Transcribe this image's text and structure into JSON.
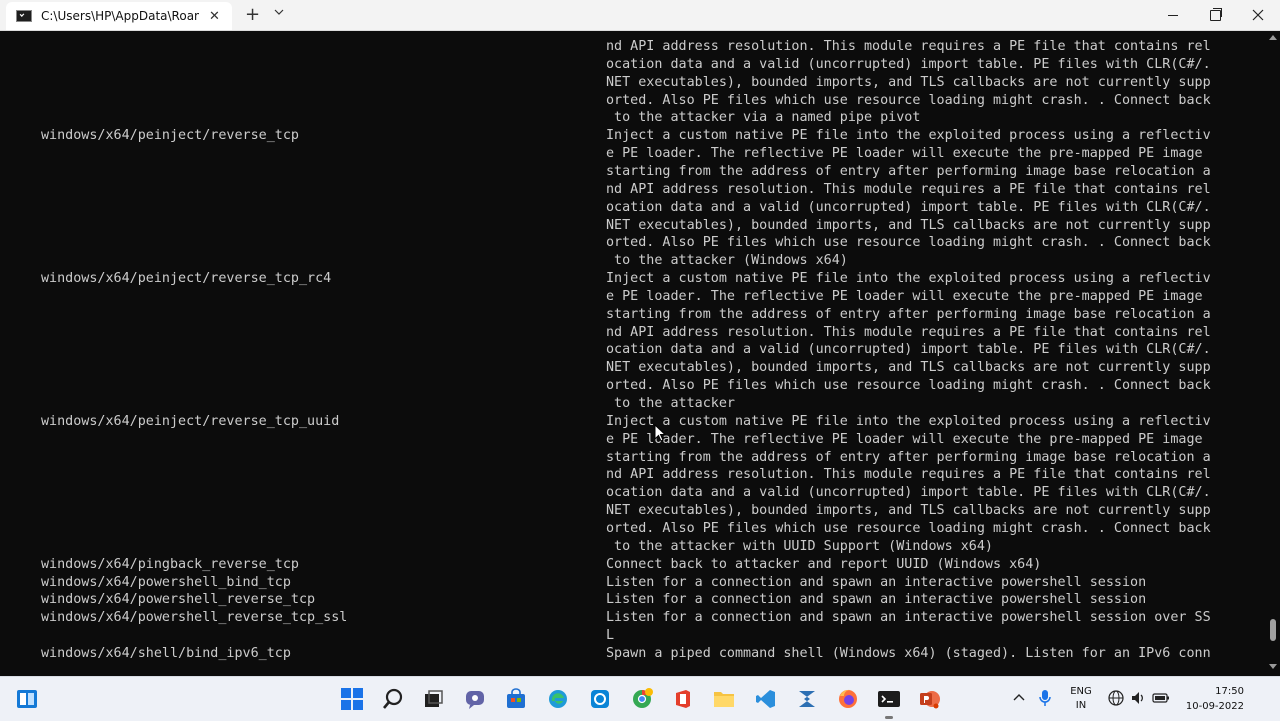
{
  "window": {
    "tab_title": "C:\\Users\\HP\\AppData\\Roaming",
    "tab_close": "✕",
    "new_tab": "+",
    "dropdown": "⌄"
  },
  "terminal": {
    "lines": [
      {
        "name": "",
        "desc": "nd API address resolution. This module requires a PE file that contains rel"
      },
      {
        "name": "",
        "desc": "ocation data and a valid (uncorrupted) import table. PE files with CLR(C#/."
      },
      {
        "name": "",
        "desc": "NET executables), bounded imports, and TLS callbacks are not currently supp"
      },
      {
        "name": "",
        "desc": "orted. Also PE files which use resource loading might crash. . Connect back"
      },
      {
        "name": "",
        "desc": " to the attacker via a named pipe pivot"
      },
      {
        "name": "windows/x64/peinject/reverse_tcp",
        "desc": "Inject a custom native PE file into the exploited process using a reflectiv"
      },
      {
        "name": "",
        "desc": "e PE loader. The reflective PE loader will execute the pre-mapped PE image"
      },
      {
        "name": "",
        "desc": "starting from the address of entry after performing image base relocation a"
      },
      {
        "name": "",
        "desc": "nd API address resolution. This module requires a PE file that contains rel"
      },
      {
        "name": "",
        "desc": "ocation data and a valid (uncorrupted) import table. PE files with CLR(C#/."
      },
      {
        "name": "",
        "desc": "NET executables), bounded imports, and TLS callbacks are not currently supp"
      },
      {
        "name": "",
        "desc": "orted. Also PE files which use resource loading might crash. . Connect back"
      },
      {
        "name": "",
        "desc": " to the attacker (Windows x64)"
      },
      {
        "name": "windows/x64/peinject/reverse_tcp_rc4",
        "desc": "Inject a custom native PE file into the exploited process using a reflectiv"
      },
      {
        "name": "",
        "desc": "e PE loader. The reflective PE loader will execute the pre-mapped PE image"
      },
      {
        "name": "",
        "desc": "starting from the address of entry after performing image base relocation a"
      },
      {
        "name": "",
        "desc": "nd API address resolution. This module requires a PE file that contains rel"
      },
      {
        "name": "",
        "desc": "ocation data and a valid (uncorrupted) import table. PE files with CLR(C#/."
      },
      {
        "name": "",
        "desc": "NET executables), bounded imports, and TLS callbacks are not currently supp"
      },
      {
        "name": "",
        "desc": "orted. Also PE files which use resource loading might crash. . Connect back"
      },
      {
        "name": "",
        "desc": " to the attacker"
      },
      {
        "name": "windows/x64/peinject/reverse_tcp_uuid",
        "desc": "Inject a custom native PE file into the exploited process using a reflectiv"
      },
      {
        "name": "",
        "desc": "e PE loader. The reflective PE loader will execute the pre-mapped PE image"
      },
      {
        "name": "",
        "desc": "starting from the address of entry after performing image base relocation a"
      },
      {
        "name": "",
        "desc": "nd API address resolution. This module requires a PE file that contains rel"
      },
      {
        "name": "",
        "desc": "ocation data and a valid (uncorrupted) import table. PE files with CLR(C#/."
      },
      {
        "name": "",
        "desc": "NET executables), bounded imports, and TLS callbacks are not currently supp"
      },
      {
        "name": "",
        "desc": "orted. Also PE files which use resource loading might crash. . Connect back"
      },
      {
        "name": "",
        "desc": " to the attacker with UUID Support (Windows x64)"
      },
      {
        "name": "windows/x64/pingback_reverse_tcp",
        "desc": "Connect back to attacker and report UUID (Windows x64)"
      },
      {
        "name": "windows/x64/powershell_bind_tcp",
        "desc": "Listen for a connection and spawn an interactive powershell session"
      },
      {
        "name": "windows/x64/powershell_reverse_tcp",
        "desc": "Listen for a connection and spawn an interactive powershell session"
      },
      {
        "name": "windows/x64/powershell_reverse_tcp_ssl",
        "desc": "Listen for a connection and spawn an interactive powershell session over SS"
      },
      {
        "name": "",
        "desc": "L"
      },
      {
        "name": "windows/x64/shell/bind_ipv6_tcp",
        "desc": "Spawn a piped command shell (Windows x64) (staged). Listen for an IPv6 conn"
      }
    ]
  },
  "taskbar": {
    "language": {
      "line1": "ENG",
      "line2": "IN"
    },
    "time": "17:50",
    "date": "10-09-2022"
  },
  "colors": {
    "terminal_bg": "#0c0c0c",
    "terminal_fg": "#cccccc",
    "titlebar_bg": "#f3f3f3",
    "taskbar_bg": "#eef1f7",
    "windows_blue": "#1a73e8"
  }
}
